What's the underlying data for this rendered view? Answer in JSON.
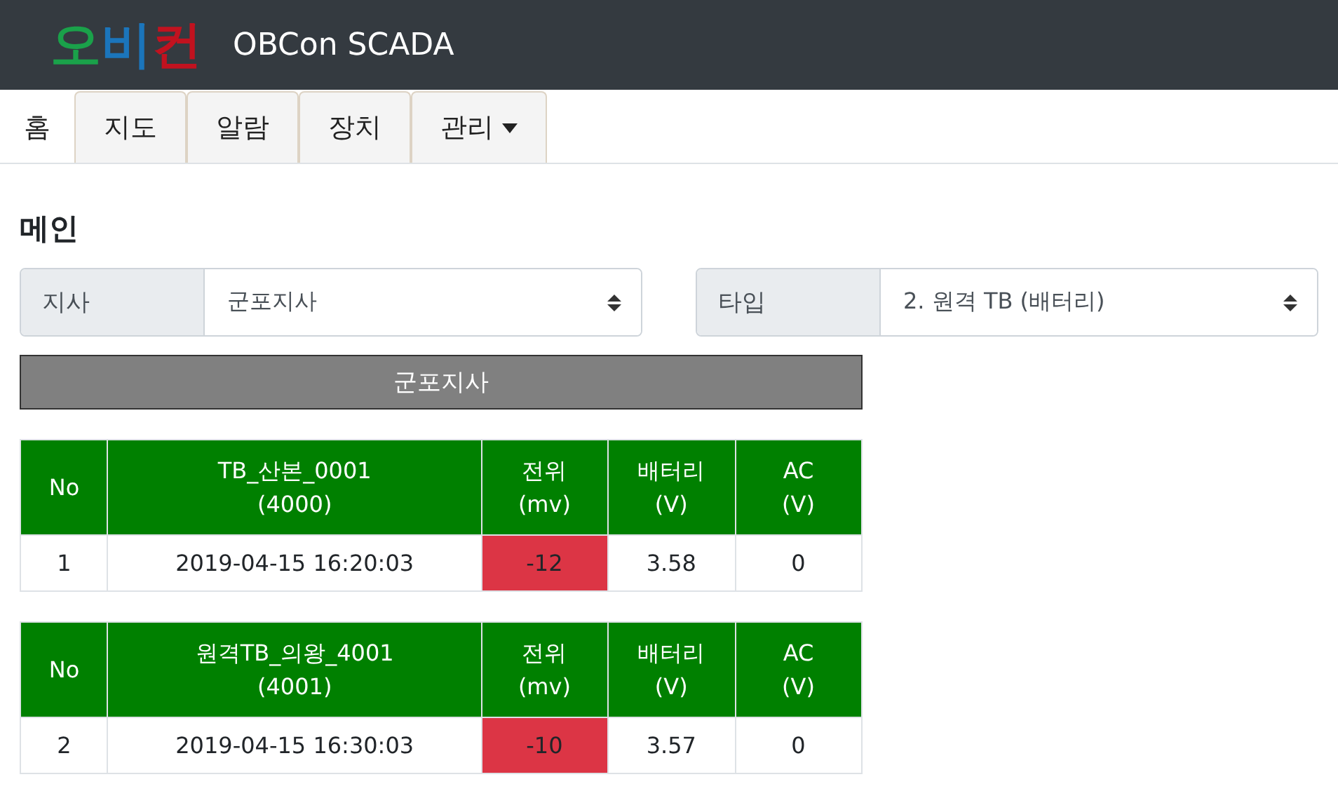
{
  "navbar": {
    "logo": [
      {
        "text": "오",
        "color": "#1aa14a"
      },
      {
        "text": "비",
        "color": "#1b75bb"
      },
      {
        "text": "컨",
        "color": "#c1121f"
      }
    ],
    "title": "OBCon SCADA"
  },
  "tabs": [
    {
      "label": "홈",
      "selected": true,
      "kind": "plain"
    },
    {
      "label": "지도",
      "selected": false,
      "kind": "plain"
    },
    {
      "label": "알람",
      "selected": false,
      "kind": "plain"
    },
    {
      "label": "장치",
      "selected": false,
      "kind": "plain"
    },
    {
      "label": "관리",
      "selected": false,
      "kind": "dropdown"
    }
  ],
  "heading": "메인",
  "filters": [
    {
      "label": "지사",
      "value": "군포지사"
    },
    {
      "label": "타입",
      "value": "2. 원격 TB (배터리)"
    }
  ],
  "branch_bar": "군포지사",
  "tables": [
    {
      "columns": [
        {
          "title": "No"
        },
        {
          "title": "TB_산본_0001",
          "unit": "(4000)"
        },
        {
          "title": "전위",
          "unit": "(mv)"
        },
        {
          "title": "배터리",
          "unit": "(V)"
        },
        {
          "title": "AC",
          "unit": "(V)"
        }
      ],
      "rows": [
        {
          "cells": [
            {
              "text": "1",
              "alarm": false
            },
            {
              "text": "2019-04-15 16:20:03",
              "alarm": false
            },
            {
              "text": "-12",
              "alarm": true
            },
            {
              "text": "3.58",
              "alarm": false
            },
            {
              "text": "0",
              "alarm": false
            }
          ]
        }
      ]
    },
    {
      "columns": [
        {
          "title": "No"
        },
        {
          "title": "원격TB_의왕_4001",
          "unit": "(4001)"
        },
        {
          "title": "전위",
          "unit": "(mv)"
        },
        {
          "title": "배터리",
          "unit": "(V)"
        },
        {
          "title": "AC",
          "unit": "(V)"
        }
      ],
      "rows": [
        {
          "cells": [
            {
              "text": "2",
              "alarm": false
            },
            {
              "text": "2019-04-15 16:30:03",
              "alarm": false
            },
            {
              "text": "-10",
              "alarm": true
            },
            {
              "text": "3.57",
              "alarm": false
            },
            {
              "text": "0",
              "alarm": false
            }
          ]
        }
      ]
    }
  ]
}
